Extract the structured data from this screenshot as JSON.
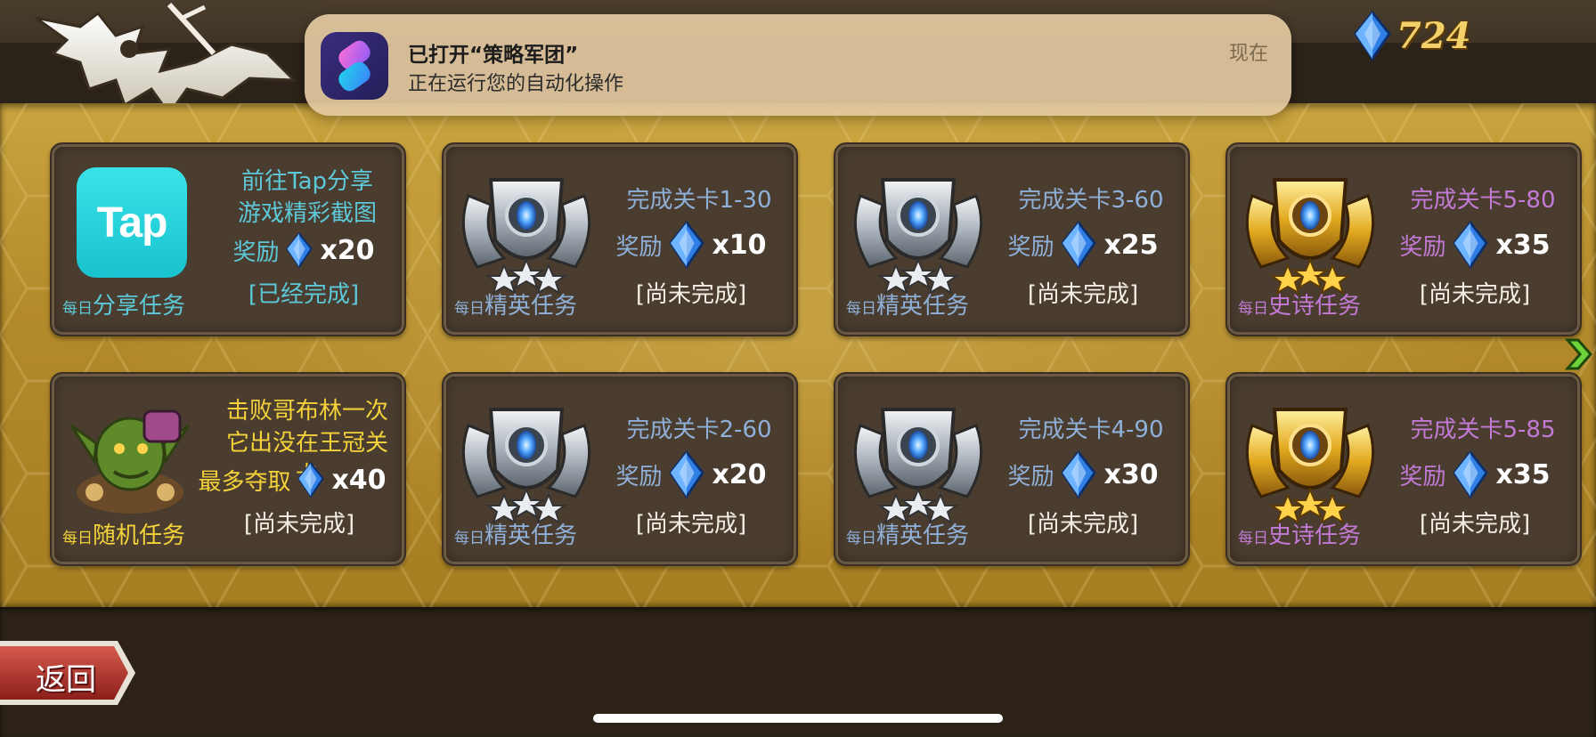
{
  "gem_counter": {
    "icon": "blue-gem-icon",
    "value": "724"
  },
  "notification": {
    "app_icon": "shortcuts-app-icon",
    "title": "已打开“策略军团”",
    "body": "正在运行您的自动化操作",
    "time": "现在"
  },
  "tasks": [
    {
      "icon": "tap-app-icon",
      "tap_label": "Tap",
      "lines": [
        "前往Tap分享",
        "游戏精彩截图"
      ],
      "reward_label": "奖励",
      "reward_icon": "blue-gem-icon",
      "reward_count": "x20",
      "status": "[已经完成]",
      "caption_small": "每日",
      "caption_big": "分享任务",
      "accent": "#5dc8d8"
    },
    {
      "icon": "silver-emblem-icon",
      "lines": [
        "完成关卡1-30"
      ],
      "reward_label": "奖励",
      "reward_icon": "blue-gem-icon",
      "reward_count": "x10",
      "status": "[尚未完成]",
      "caption_small": "每日",
      "caption_big": "精英任务",
      "accent": "#8fb0d8"
    },
    {
      "icon": "silver-emblem-icon",
      "lines": [
        "完成关卡3-60"
      ],
      "reward_label": "奖励",
      "reward_icon": "blue-gem-icon",
      "reward_count": "x25",
      "status": "[尚未完成]",
      "caption_small": "每日",
      "caption_big": "精英任务",
      "accent": "#8fb0d8"
    },
    {
      "icon": "gold-emblem-icon",
      "lines": [
        "完成关卡5-80"
      ],
      "reward_label": "奖励",
      "reward_icon": "blue-gem-icon",
      "reward_count": "x35",
      "status": "[尚未完成]",
      "caption_small": "每日",
      "caption_big": "史诗任务",
      "accent": "#c37ad6"
    },
    {
      "icon": "goblin-icon",
      "lines": [
        "击败哥布林一次",
        "它出没在王冠关卡"
      ],
      "reward_label": "最多夺取",
      "reward_icon": "blue-gem-icon",
      "reward_count": "x40",
      "status": "[尚未完成]",
      "caption_small": "每日",
      "caption_big": "随机任务",
      "accent": "#f4d23a"
    },
    {
      "icon": "silver-emblem-icon",
      "lines": [
        "完成关卡2-60"
      ],
      "reward_label": "奖励",
      "reward_icon": "blue-gem-icon",
      "reward_count": "x20",
      "status": "[尚未完成]",
      "caption_small": "每日",
      "caption_big": "精英任务",
      "accent": "#8fb0d8"
    },
    {
      "icon": "silver-emblem-icon",
      "lines": [
        "完成关卡4-90"
      ],
      "reward_label": "奖励",
      "reward_icon": "blue-gem-icon",
      "reward_count": "x30",
      "status": "[尚未完成]",
      "caption_small": "每日",
      "caption_big": "精英任务",
      "accent": "#8fb0d8"
    },
    {
      "icon": "gold-emblem-icon",
      "lines": [
        "完成关卡5-85"
      ],
      "reward_label": "奖励",
      "reward_icon": "blue-gem-icon",
      "reward_count": "x35",
      "status": "[尚未完成]",
      "caption_small": "每日",
      "caption_big": "史诗任务",
      "accent": "#c37ad6"
    }
  ],
  "next_arrow": {
    "icon": "green-chevron-right-icon"
  },
  "back_button": {
    "label": "返回"
  }
}
